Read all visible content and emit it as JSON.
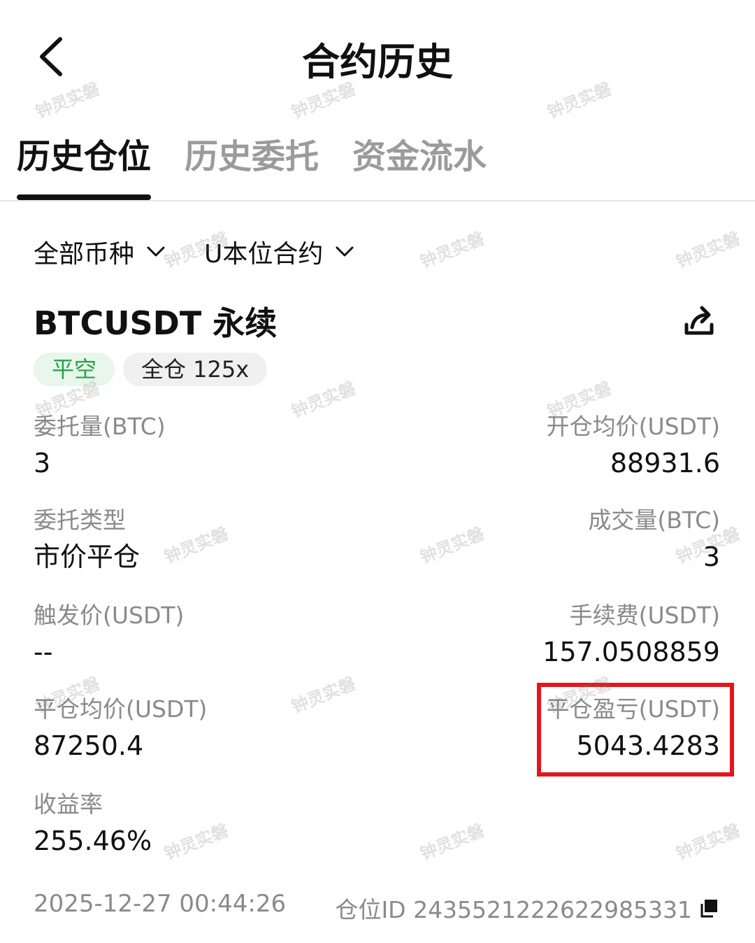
{
  "header": {
    "title": "合约历史"
  },
  "tabs": [
    {
      "label": "历史仓位",
      "active": true
    },
    {
      "label": "历史委托",
      "active": false
    },
    {
      "label": "资金流水",
      "active": false
    }
  ],
  "filters": {
    "coin": "全部币种",
    "contract": "U本位合约"
  },
  "position": {
    "symbol": "BTCUSDT 永续",
    "badges": {
      "side": "平空",
      "margin": "全仓 125x"
    },
    "fields": {
      "order_qty_label": "委托量(BTC)",
      "order_qty_value": "3",
      "open_avg_label": "开仓均价(USDT)",
      "open_avg_value": "88931.6",
      "order_type_label": "委托类型",
      "order_type_value": "市价平仓",
      "filled_qty_label": "成交量(BTC)",
      "filled_qty_value": "3",
      "trigger_label": "触发价(USDT)",
      "trigger_value": "--",
      "fee_label": "手续费(USDT)",
      "fee_value": "157.0508859",
      "close_avg_label": "平仓均价(USDT)",
      "close_avg_value": "87250.4",
      "pnl_label": "平仓盈亏(USDT)",
      "pnl_value": "5043.4283",
      "roi_label": "收益率",
      "roi_value": "255.46%"
    },
    "timestamp": "2025-12-27 00:44:26",
    "position_id": "仓位ID 2435521222622985331"
  },
  "watermark": "钟灵实磐",
  "colors": {
    "accent_green": "#27a348",
    "highlight_red": "#e4161b"
  },
  "icons": {
    "back": "chevron-left-icon",
    "share": "share-icon",
    "copy": "copy-icon",
    "dropdown": "chevron-down-icon"
  }
}
